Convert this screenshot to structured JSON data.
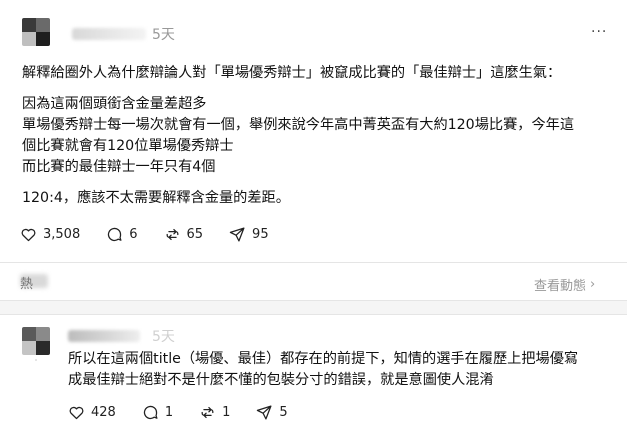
{
  "post": {
    "time": "5天",
    "more_label": "···",
    "lines": [
      "解釋給圈外人為什麼辯論人對「單場優秀辯士」被竄成比賽的「最佳辯士」這麼生氣：",
      "因為這兩個頭銜含金量差超多",
      "單場優秀辯士每一場次就會有一個，舉例來說今年高中菁英盃有大約120場比賽，今年這",
      "個比賽就會有120位單場優秀辯士",
      "而比賽的最佳辯士一年只有4個",
      "120:4，應該不太需要解釋含金量的差距。"
    ],
    "actions": {
      "likes": "3,508",
      "comments": "6",
      "reposts": "65",
      "shares": "95"
    }
  },
  "activity": {
    "label": "查看動態",
    "chevron": "›",
    "partial_char": "熱"
  },
  "reply": {
    "time": "5天",
    "lines": [
      "所以在這兩個title（場優、最佳）都存在的前提下，知情的選手在履歷上把場優寫",
      "成最佳辯士絕對不是什麼不懂的包裝分寸的錯誤，就是意圖使人混淆"
    ],
    "actions": {
      "likes": "428",
      "comments": "1",
      "reposts": "1",
      "shares": "5"
    }
  },
  "colors": {
    "muted": "#999999",
    "divider": "#e5e5e5",
    "text": "#111111"
  },
  "icons": [
    "heart-icon",
    "comment-icon",
    "repost-icon",
    "share-icon",
    "more-icon",
    "chevron-right-icon"
  ]
}
